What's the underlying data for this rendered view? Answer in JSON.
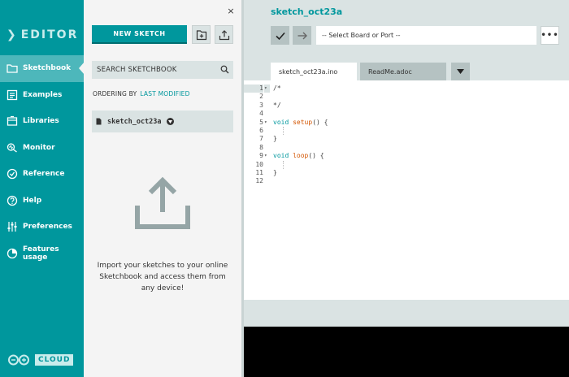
{
  "nav": {
    "title": "EDITOR",
    "items": [
      {
        "label": "Sketchbook",
        "icon": "folder-icon",
        "active": true
      },
      {
        "label": "Examples",
        "icon": "examples-icon",
        "active": false
      },
      {
        "label": "Libraries",
        "icon": "library-icon",
        "active": false
      },
      {
        "label": "Monitor",
        "icon": "monitor-icon",
        "active": false
      },
      {
        "label": "Reference",
        "icon": "reference-icon",
        "active": false
      },
      {
        "label": "Help",
        "icon": "help-icon",
        "active": false
      },
      {
        "label": "Preferences",
        "icon": "preferences-icon",
        "active": false
      },
      {
        "label": "Features usage",
        "icon": "features-icon",
        "active": false
      }
    ],
    "cloud_label": "CLOUD"
  },
  "panel": {
    "close_label": "×",
    "new_sketch_label": "NEW SKETCH",
    "search_placeholder": "SEARCH SKETCHBOOK",
    "ordering_label": "ORDERING BY",
    "ordering_value": "LAST MODIFIED",
    "sketch_name": "sketch_oct23a",
    "import_text": "Import your sketches to your online Sketchbook and access them from any device!"
  },
  "editor": {
    "sketch_title": "sketch_oct23a",
    "board_select": "-- Select Board or Port --",
    "more_label": "•••",
    "tabs": [
      {
        "label": "sketch_oct23a.ino",
        "active": true
      },
      {
        "label": "ReadMe.adoc",
        "active": false
      }
    ],
    "lines": [
      {
        "num": "1",
        "fold": "▾",
        "code": "/*"
      },
      {
        "num": "2",
        "fold": "",
        "code": ""
      },
      {
        "num": "3",
        "fold": "",
        "code": "*/"
      },
      {
        "num": "4",
        "fold": "",
        "code": ""
      },
      {
        "num": "5",
        "fold": "▾",
        "code": "void setup() {"
      },
      {
        "num": "6",
        "fold": "",
        "code": ""
      },
      {
        "num": "7",
        "fold": "",
        "code": "}"
      },
      {
        "num": "8",
        "fold": "",
        "code": ""
      },
      {
        "num": "9",
        "fold": "▾",
        "code": "void loop() {"
      },
      {
        "num": "10",
        "fold": "",
        "code": ""
      },
      {
        "num": "11",
        "fold": "",
        "code": "}"
      },
      {
        "num": "12",
        "fold": "",
        "code": ""
      }
    ]
  },
  "colors": {
    "brand": "#00979d",
    "nav_active": "#4db7bb",
    "panel_bg": "#f4f4f4",
    "console": "#000000"
  }
}
